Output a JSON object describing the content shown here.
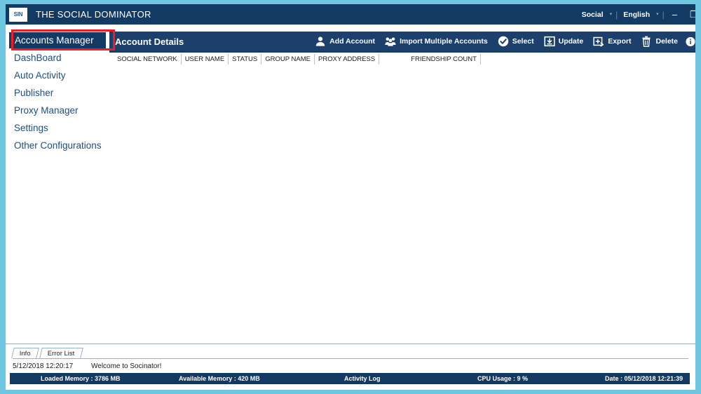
{
  "window": {
    "logo_text": "SIN",
    "app_title": "THE SOCIAL DOMINATOR",
    "social_label": "Social",
    "language_label": "English",
    "minimize_glyph": "–",
    "restore_glyph": "❐",
    "caret_glyph": "▾",
    "separator_glyph": "|"
  },
  "sidebar": {
    "items": [
      {
        "label": "Accounts Manager",
        "active": true
      },
      {
        "label": "DashBoard",
        "active": false
      },
      {
        "label": "Auto Activity",
        "active": false
      },
      {
        "label": "Publisher",
        "active": false
      },
      {
        "label": "Proxy Manager",
        "active": false
      },
      {
        "label": "Settings",
        "active": false
      },
      {
        "label": "Other Configurations",
        "active": false
      }
    ]
  },
  "toolbar": {
    "panel_title": "Account Details",
    "actions": [
      {
        "label": "Add Account",
        "icon": "person-icon"
      },
      {
        "label": "Import Multiple Accounts",
        "icon": "people-group-icon"
      },
      {
        "label": "Select",
        "icon": "check-circle-icon"
      },
      {
        "label": "Update",
        "icon": "download-box-icon"
      },
      {
        "label": "Export",
        "icon": "export-box-icon"
      },
      {
        "label": "Delete",
        "icon": "trash-icon"
      }
    ]
  },
  "grid": {
    "columns": [
      {
        "label": "SOCIAL NETWORK",
        "gap": false
      },
      {
        "label": "USER NAME",
        "gap": false
      },
      {
        "label": "STATUS",
        "gap": false
      },
      {
        "label": "GROUP NAME",
        "gap": false
      },
      {
        "label": "PROXY ADDRESS",
        "gap": false
      },
      {
        "label": "FRIENDSHIP COUNT",
        "gap": true
      }
    ],
    "rows": []
  },
  "logpanel": {
    "tabs": [
      {
        "label": "Info",
        "active": true
      },
      {
        "label": "Error List",
        "active": false
      }
    ],
    "entries": [
      {
        "timestamp": "5/12/2018 12:20:17",
        "message": "Welcome to Socinator!"
      }
    ]
  },
  "statusbar": {
    "loaded_memory": "Loaded Memory : 3786 MB",
    "available_memory": "Available Memory : 420  MB",
    "activity_log": "Activity Log",
    "cpu_usage": "CPU Usage : 9 %",
    "date": "Date : 05/12/2018 12:21:39"
  },
  "colors": {
    "frame": "#6ec6e0",
    "titlebar": "#123a63",
    "toolbar": "#1d3f6b",
    "accent_text": "#1c4e80",
    "annotation": "#ee1c25"
  }
}
